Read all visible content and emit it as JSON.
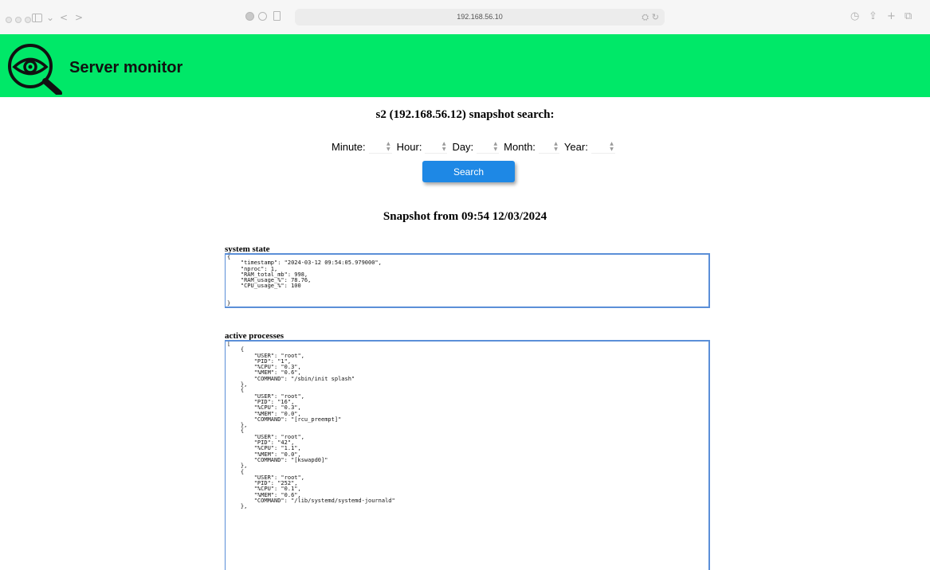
{
  "browser": {
    "address": "192.168.56.10",
    "nav_back": "<",
    "nav_forward": ">"
  },
  "header": {
    "title": "Server monitor",
    "logo_icon": "eye-magnifier-icon",
    "background_color": "#00e868"
  },
  "search": {
    "heading": "s2 (192.168.56.12) snapshot search:",
    "fields": [
      {
        "label": "Minute:",
        "value": ""
      },
      {
        "label": "Hour:",
        "value": ""
      },
      {
        "label": "Day:",
        "value": ""
      },
      {
        "label": "Month:",
        "value": ""
      },
      {
        "label": "Year:",
        "value": ""
      }
    ],
    "button_label": "Search",
    "button_color": "#1e88e5"
  },
  "snapshot": {
    "heading": "Snapshot from 09:54 12/03/2024",
    "system_state_label": "system state",
    "system_state_json": "{\n    \"timestamp\": \"2024-03-12 09:54:05.979000\",\n    \"nproc\": 1,\n    \"RAM_total_mb\": 998,\n    \"RAM_usage_%\": 78.76,\n    \"CPU_usage_%\": 100\n\n\n}",
    "active_processes_label": "active processes",
    "active_processes_json": "[\n    {\n        \"USER\": \"root\",\n        \"PID\": \"1\",\n        \"%CPU\": \"0.3\",\n        \"%MEM\": \"0.6\",\n        \"COMMAND\": \"/sbin/init splash\"\n    },\n    {\n        \"USER\": \"root\",\n        \"PID\": \"16\",\n        \"%CPU\": \"0.3\",\n        \"%MEM\": \"0.0\",\n        \"COMMAND\": \"[rcu_preempt]\"\n    },\n    {\n        \"USER\": \"root\",\n        \"PID\": \"42\",\n        \"%CPU\": \"1.1\",\n        \"%MEM\": \"0.0\",\n        \"COMMAND\": \"[kswapd0]\"\n    },\n    {\n        \"USER\": \"root\",\n        \"PID\": \"252\",\n        \"%CPU\": \"0.1\",\n        \"%MEM\": \"0.6\",\n        \"COMMAND\": \"/lib/systemd/systemd-journald\"\n    },"
  }
}
